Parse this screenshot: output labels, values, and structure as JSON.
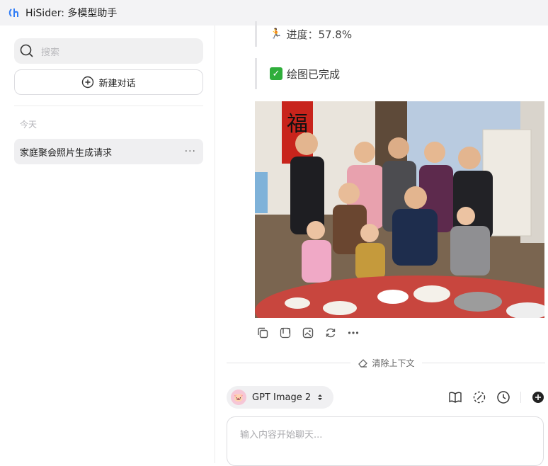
{
  "window": {
    "title": "HiSider: 多模型助手"
  },
  "sidebar": {
    "search_placeholder": "搜索",
    "new_chat_label": "新建对话",
    "section_today": "今天",
    "chats": [
      {
        "title": "家庭聚会照片生成请求",
        "more": "···"
      }
    ]
  },
  "main": {
    "progress_text": "进度：57.8%",
    "done_text": "绘图已完成",
    "clear_context_label": "清除上下文",
    "model_name": "GPT Image 2",
    "input_placeholder": "输入内容开始聊天..."
  },
  "icons": {
    "logo": "hisider-logo-icon",
    "search": "search-icon",
    "new_chat": "plus-circle-icon",
    "check": "check-icon",
    "copy": "copy-icon",
    "quote": "quote-icon",
    "image": "image-icon",
    "regenerate": "refresh-icon",
    "more": "more-icon",
    "eraser": "eraser-icon",
    "book": "book-icon",
    "tools": "dashed-circle-icon",
    "history": "clock-icon",
    "add": "add-circle-icon"
  },
  "colors": {
    "accent": "#2f7cf6",
    "check_green": "#2fae3b",
    "sidebar_selected": "#efeff1"
  }
}
